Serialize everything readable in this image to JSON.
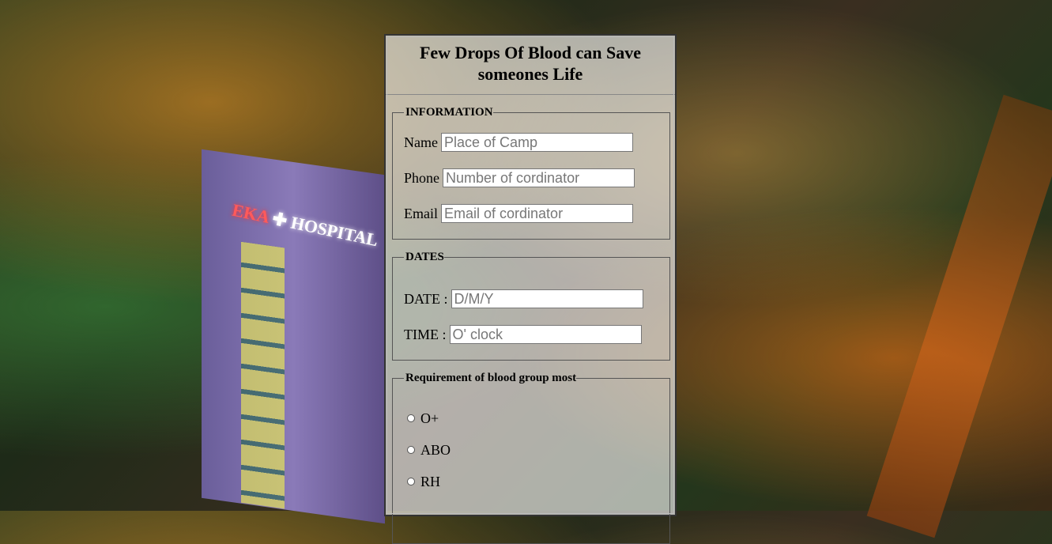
{
  "background": {
    "sign_brand": "EKA",
    "sign_word": "HOSPITAL"
  },
  "form": {
    "title": "Few Drops Of Blood can Save someones Life",
    "information": {
      "legend": "INFORMATION",
      "fields": [
        {
          "label": "Name",
          "placeholder": "Place of Camp"
        },
        {
          "label": "Phone",
          "placeholder": "Number of cordinator"
        },
        {
          "label": "Email",
          "placeholder": "Email of cordinator"
        }
      ]
    },
    "dates": {
      "legend": "DATES",
      "fields": [
        {
          "label": "DATE :",
          "placeholder": "D/M/Y"
        },
        {
          "label": "TIME :",
          "placeholder": "O' clock"
        }
      ]
    },
    "blood": {
      "legend": "Requirement of blood group most",
      "options": [
        "O+",
        "ABO",
        "RH"
      ]
    }
  }
}
